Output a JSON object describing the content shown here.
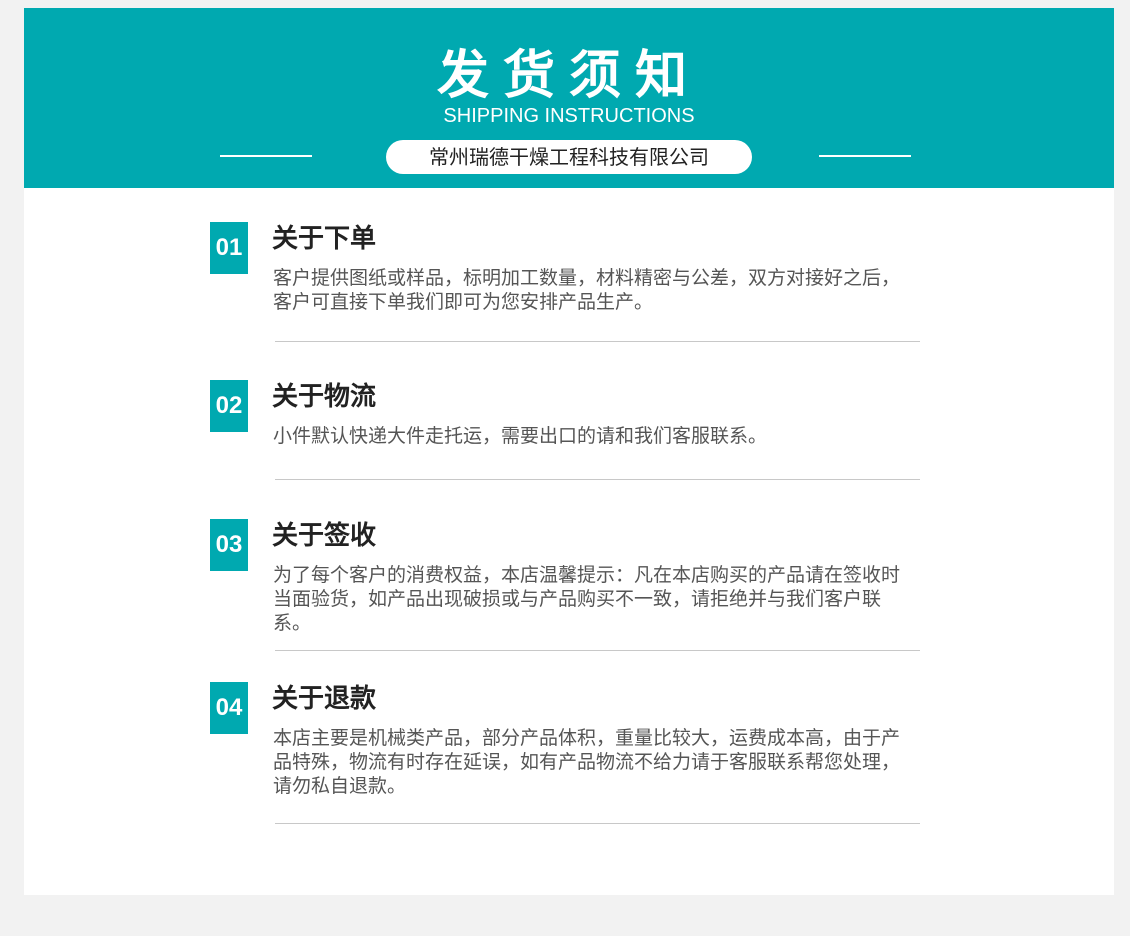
{
  "header": {
    "title": "发货须知",
    "subtitle": "SHIPPING INSTRUCTIONS",
    "company": "常州瑞德干燥工程科技有限公司"
  },
  "sections": [
    {
      "number": "01",
      "title": "关于下单",
      "body": "客户提供图纸或样品，标明加工数量，材料精密与公差，双方对接好之后，客户可直接下单我们即可为您安排产品生产。"
    },
    {
      "number": "02",
      "title": "关于物流",
      "body": "小件默认快递大件走托运，需要出口的请和我们客服联系。"
    },
    {
      "number": "03",
      "title": "关于签收",
      "body": "为了每个客户的消费权益，本店温馨提示：凡在本店购买的产品请在签收时当面验货，如产品出现破损或与产品购买不一致，请拒绝并与我们客户联系。"
    },
    {
      "number": "04",
      "title": "关于退款",
      "body": "本店主要是机械类产品，部分产品体积，重量比较大，运费成本高，由于产品特殊，物流有时存在延误，如有产品物流不给力请于客服联系帮您处理，请勿私自退款。"
    }
  ],
  "colors": {
    "accent": "#00a9b0",
    "page_background": "#f2f2f2",
    "title_text": "#222222",
    "body_text": "#555555",
    "divider": "#c8c8c8"
  }
}
